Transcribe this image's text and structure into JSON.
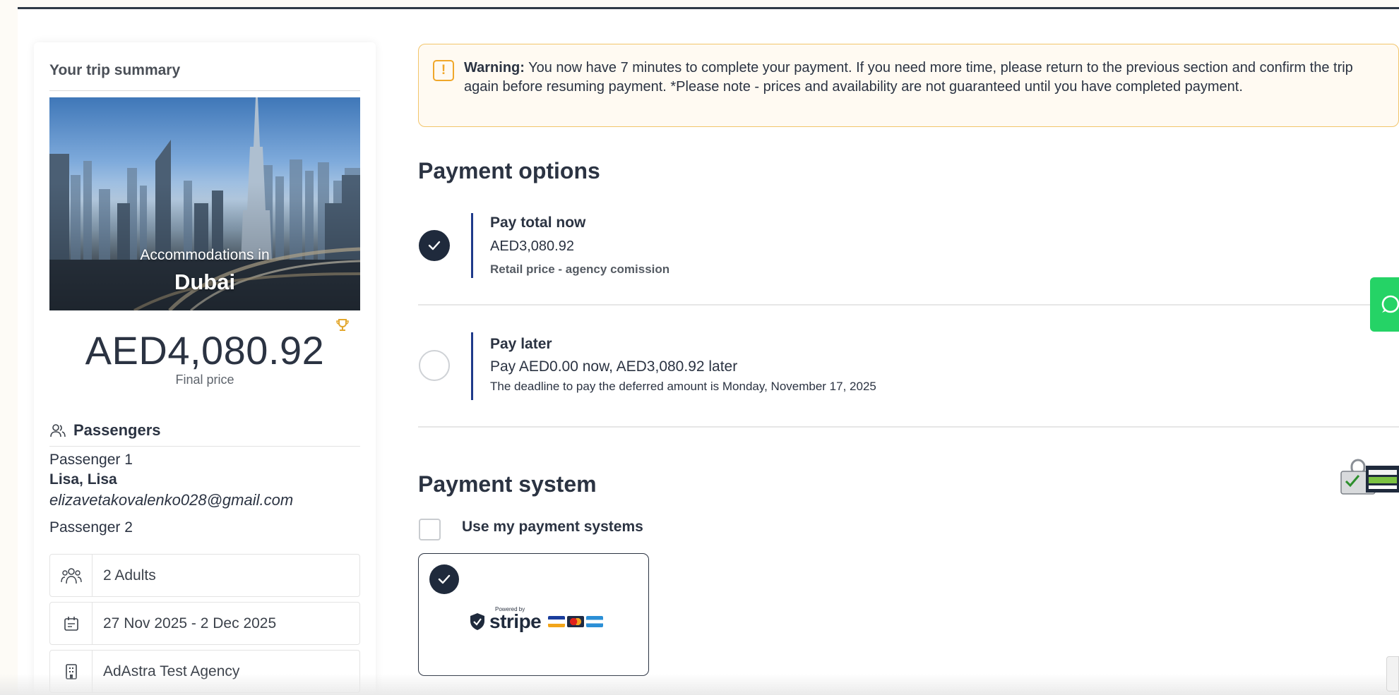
{
  "sidebar": {
    "title": "Your trip summary",
    "photo": {
      "line1": "Accommodations in",
      "line2": "Dubai"
    },
    "price": "AED4,080.92",
    "price_label": "Final price",
    "passengers_title": "Passengers",
    "passenger1_label": "Passenger 1",
    "passenger1_name": "Lisa, Lisa",
    "passenger1_email": "elizavetakovalenko028@gmail.com",
    "passenger2_label": "Passenger 2",
    "adults": "2 Adults",
    "dates": "27 Nov 2025 - 2 Dec 2025",
    "agency": "AdAstra Test Agency"
  },
  "warning": {
    "icon": "!",
    "bold": "Warning:",
    "text": " You now have 7 minutes to complete your payment. If you need more time, please return to the previous section and confirm the trip again before resuming payment. *Please note - prices and availability are not guaranteed until you have completed payment."
  },
  "payment_options": {
    "title": "Payment options",
    "options": [
      {
        "title": "Pay total now",
        "amount": "AED3,080.92",
        "sub": "Retail price - agency comission",
        "selected": true
      },
      {
        "title": "Pay later",
        "amount": "Pay AED0.00 now, AED3,080.92 later",
        "sub": "The deadline to pay the deferred amount is Monday, November 17, 2025",
        "selected": false
      }
    ]
  },
  "payment_system": {
    "title": "Payment system",
    "checkbox_label": "Use my payment systems",
    "provider": {
      "powered": "Powered by",
      "name": "stripe",
      "selected": true
    }
  },
  "colors": {
    "accent_dark": "#1f2a3c",
    "bar_blue": "#1f3a8a",
    "warning_border": "#f2c56b",
    "warning_icon": "#f0a72a",
    "whatsapp_green": "#25d366"
  }
}
